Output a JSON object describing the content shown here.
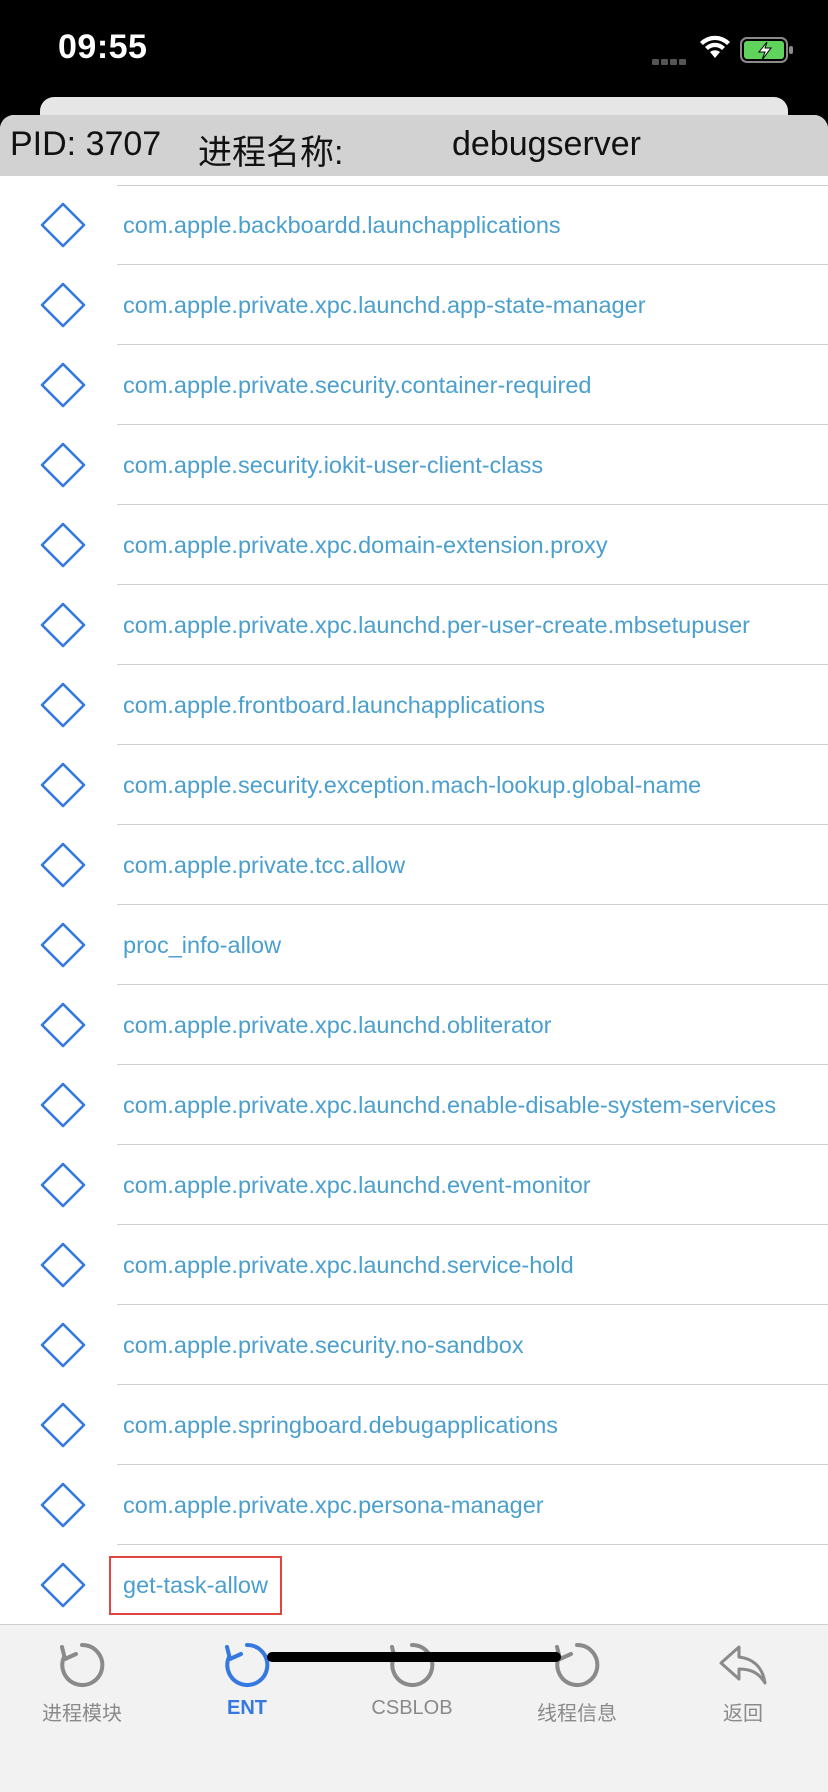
{
  "status_bar": {
    "time": "09:55"
  },
  "header": {
    "pid": "PID: 3707",
    "process_name_label": "进程名称:",
    "process_name": "debugserver"
  },
  "entitlements": [
    "com.apple.backboardd.launchapplications",
    "com.apple.private.xpc.launchd.app-state-manager",
    "com.apple.private.security.container-required",
    "com.apple.security.iokit-user-client-class",
    "com.apple.private.xpc.domain-extension.proxy",
    "com.apple.private.xpc.launchd.per-user-create.mbsetupuser",
    "com.apple.frontboard.launchapplications",
    "com.apple.security.exception.mach-lookup.global-name",
    "com.apple.private.tcc.allow",
    "proc_info-allow",
    "com.apple.private.xpc.launchd.obliterator",
    "com.apple.private.xpc.launchd.enable-disable-system-services",
    "com.apple.private.xpc.launchd.event-monitor",
    "com.apple.private.xpc.launchd.service-hold",
    "com.apple.private.security.no-sandbox",
    "com.apple.springboard.debugapplications",
    "com.apple.private.xpc.persona-manager",
    "get-task-allow"
  ],
  "highlighted_item": "get-task-allow",
  "tabs": [
    {
      "label": "进程模块",
      "icon": "refresh-icon",
      "active": false
    },
    {
      "label": "ENT",
      "icon": "refresh-icon",
      "active": true
    },
    {
      "label": "CSBLOB",
      "icon": "refresh-icon",
      "active": false
    },
    {
      "label": "线程信息",
      "icon": "refresh-icon",
      "active": false
    },
    {
      "label": "返回",
      "icon": "back-arrow-icon",
      "active": false
    }
  ],
  "colors": {
    "accent": "#3478e0",
    "link_text": "#4a9fcf",
    "highlight_border": "#e0453f",
    "header_bg": "#d2d2d2",
    "battery_green": "#5fd35b"
  }
}
